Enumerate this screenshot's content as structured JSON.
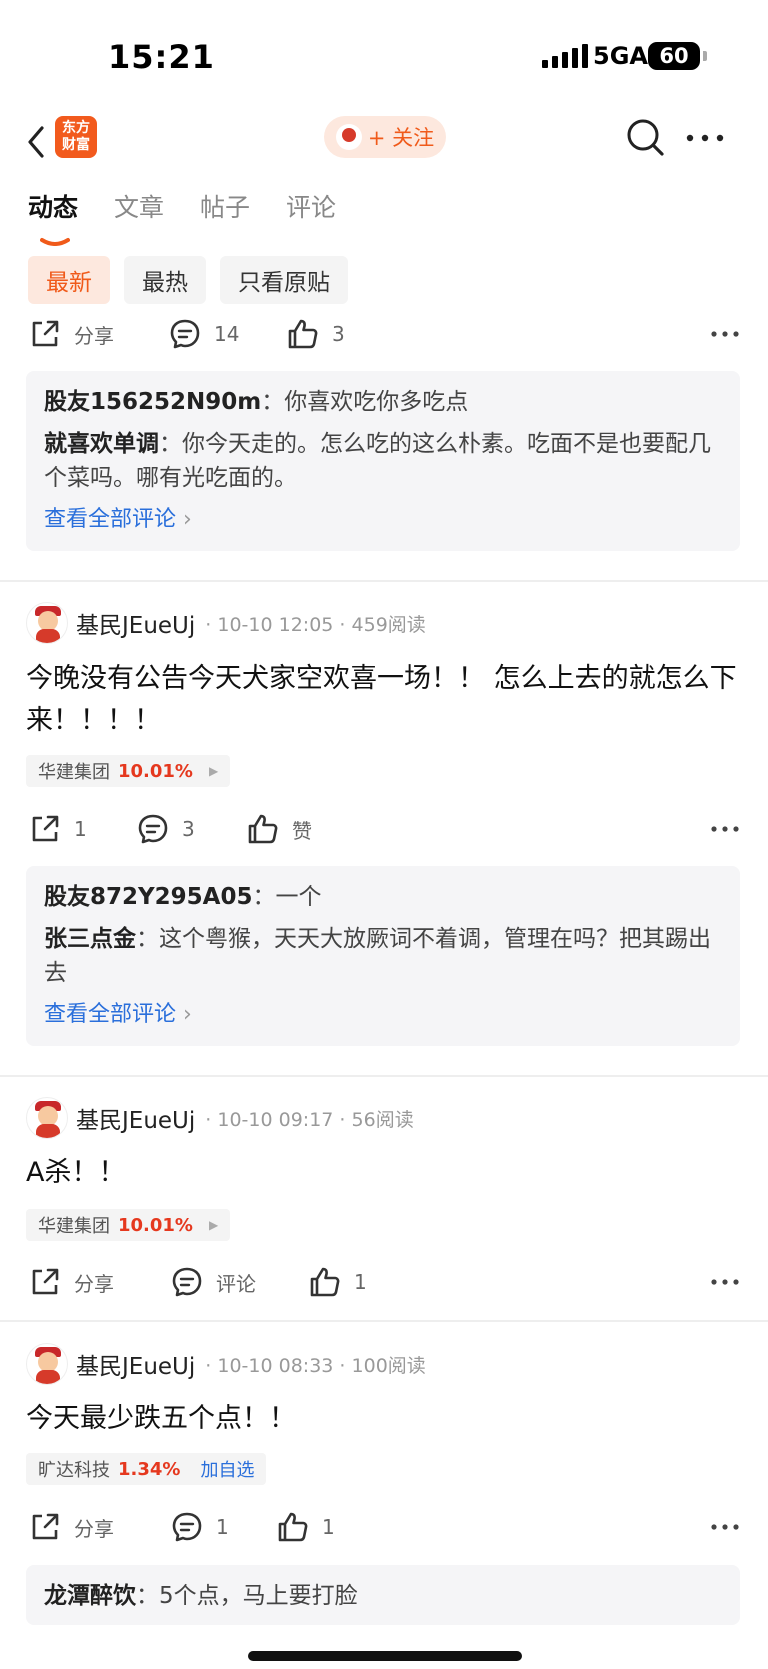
{
  "status_bar": {
    "time": "15:21",
    "network": "5GA",
    "battery": "60"
  },
  "nav": {
    "logo_line1": "东方",
    "logo_line2": "财富",
    "follow_label": "+ 关注"
  },
  "tabs": [
    {
      "label": "动态",
      "active": true
    },
    {
      "label": "文章",
      "active": false
    },
    {
      "label": "帖子",
      "active": false
    },
    {
      "label": "评论",
      "active": false
    }
  ],
  "filters": [
    {
      "label": "最新",
      "active": true
    },
    {
      "label": "最热",
      "active": false
    },
    {
      "label": "只看原贴",
      "active": false
    }
  ],
  "post0": {
    "share_label": "分享",
    "comment_count": "14",
    "like_count": "3",
    "comments": [
      {
        "user": "股友156252N90m",
        "text": "你喜欢吃你多吃点"
      },
      {
        "user": "就喜欢单调",
        "text": "你今天走的。怎么吃的这么朴素。吃面不是也要配几个菜吗。哪有光吃面的。"
      }
    ],
    "view_all": "查看全部评论"
  },
  "post1": {
    "author": "基民JEueUj",
    "time": "10-10 12:05",
    "reads": "459阅读",
    "text": "今晚没有公告今天犬家空欢喜一场！！ 怎么上去的就怎么下来！！！！",
    "stock_name": "华建集团",
    "stock_pct": "10.01%",
    "share_label": "1",
    "comment_count": "3",
    "like_label": "赞",
    "comments": [
      {
        "user": "股友872Y295A05",
        "text": "一个"
      },
      {
        "user": "张三点金",
        "text": "这个粤猴，天天大放厥词不着调，管理在吗？把其踢出去"
      }
    ],
    "view_all": "查看全部评论"
  },
  "post2": {
    "author": "基民JEueUj",
    "time": "10-10 09:17",
    "reads": "56阅读",
    "text": "A杀！！",
    "stock_name": "华建集团",
    "stock_pct": "10.01%",
    "share_label": "分享",
    "comment_label": "评论",
    "like_count": "1"
  },
  "post3": {
    "author": "基民JEueUj",
    "time": "10-10 08:33",
    "reads": "100阅读",
    "text": "今天最少跌五个点！！",
    "stock_name": "旷达科技",
    "stock_pct": "1.34%",
    "add_watch": "加自选",
    "share_label": "分享",
    "comment_count": "1",
    "like_count": "1",
    "comments": [
      {
        "user": "龙潭醉饮",
        "text": "5个点，马上要打脸"
      }
    ]
  },
  "colors": {
    "accent": "#f05a1a",
    "link": "#2a6fdb",
    "up": "#e5381e"
  },
  "icons": [
    "back-icon",
    "search-icon",
    "more-icon",
    "share-icon",
    "comment-icon",
    "like-icon"
  ]
}
